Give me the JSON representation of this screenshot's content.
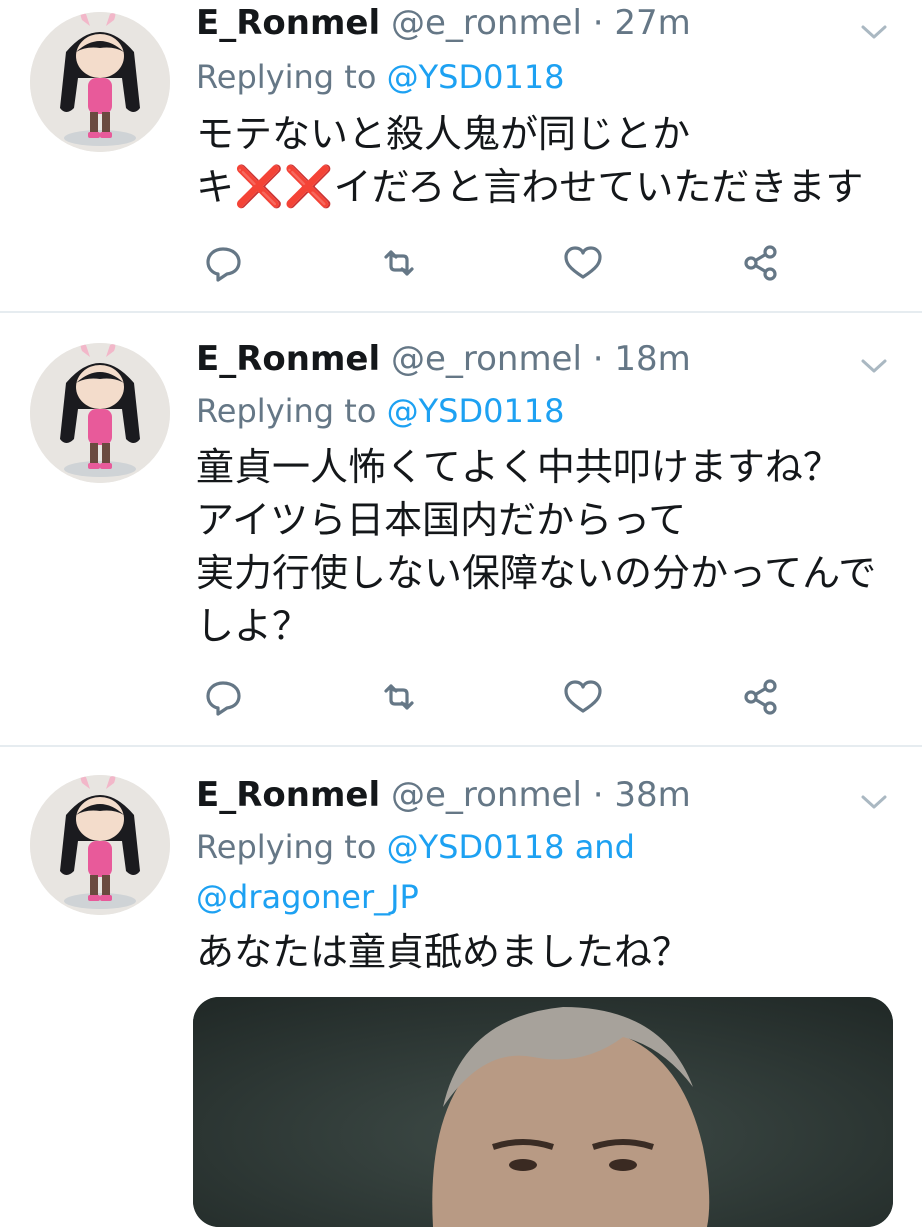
{
  "tweets": [
    {
      "display_name": "E_Ronmel",
      "handle": "@e_ronmel",
      "separator": "·",
      "time": "27m",
      "replying_prefix": "Replying to",
      "mentions": [
        "@YSD0118"
      ],
      "lines": [
        "モテないと殺人鬼が同じとか"
      ],
      "line2_pre": "キ",
      "line2_marks": "❌❌",
      "line2_post": "イだろと言わせていただきます"
    },
    {
      "display_name": "E_Ronmel",
      "handle": "@e_ronmel",
      "separator": "·",
      "time": "18m",
      "replying_prefix": "Replying to",
      "mentions": [
        "@YSD0118"
      ],
      "lines": [
        "童貞一人怖くてよく中共叩けますね？",
        "アイツら日本国内だからって",
        "実力行使しない保障ないの分かってんで",
        "しよ？"
      ]
    },
    {
      "display_name": "E_Ronmel",
      "handle": "@e_ronmel",
      "separator": "·",
      "time": "38m",
      "replying_prefix": "Replying to",
      "mentions": [
        "@YSD0118",
        "@dragoner_JP"
      ],
      "and_word": "and",
      "lines": [
        "あなたは童貞舐めましたね？"
      ]
    }
  ],
  "icons": [
    "avatar",
    "chevron-down-icon",
    "reply-icon",
    "retweet-icon",
    "like-icon",
    "share-icon"
  ],
  "colors": {
    "link": "#1da1f2",
    "meta": "#657786",
    "text": "#14171a",
    "divider": "#e6ecf0",
    "x_mark": "#dd2e44"
  }
}
